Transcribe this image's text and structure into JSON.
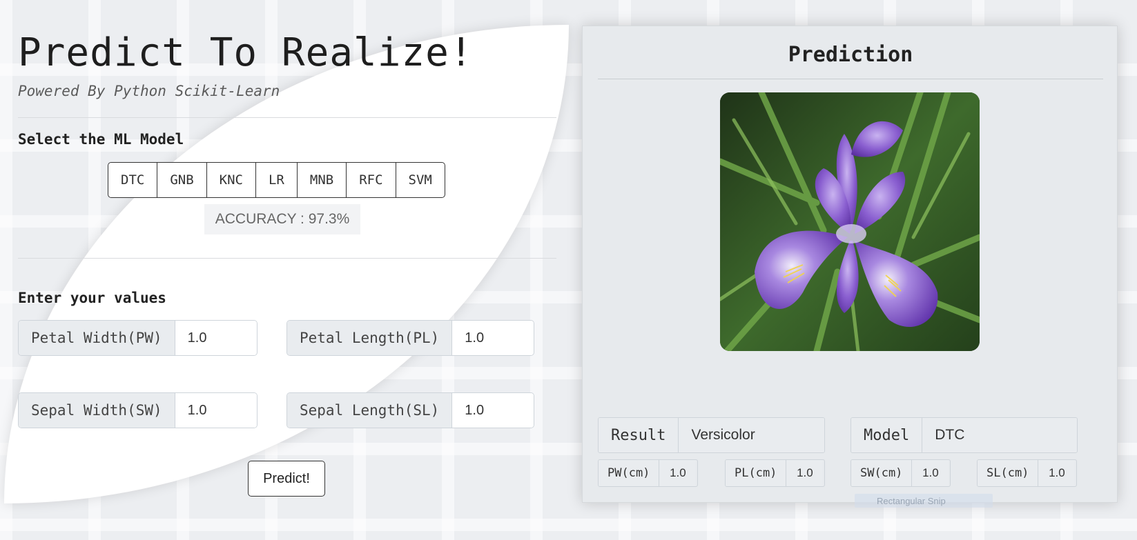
{
  "header": {
    "title": "Predict To Realize!",
    "subtitle": "Powered By Python Scikit-Learn"
  },
  "model_section": {
    "label": "Select the ML Model",
    "models": [
      "DTC",
      "GNB",
      "KNC",
      "LR",
      "MNB",
      "RFC",
      "SVM"
    ],
    "accuracy": "ACCURACY : 97.3%"
  },
  "values_section": {
    "label": "Enter your values",
    "fields": {
      "pw": {
        "label": "Petal Width(PW)",
        "value": "1.0"
      },
      "pl": {
        "label": "Petal Length(PL)",
        "value": "1.0"
      },
      "sw": {
        "label": "Sepal Width(SW)",
        "value": "1.0"
      },
      "sl": {
        "label": "Sepal Length(SL)",
        "value": "1.0"
      }
    },
    "predict_label": "Predict!"
  },
  "prediction": {
    "title": "Prediction",
    "image_icon": "iris-flower-image",
    "result_label": "Result",
    "result_value": "Versicolor",
    "model_label": "Model",
    "model_value": "DTC",
    "summary": {
      "pw": {
        "label": "PW(cm)",
        "value": "1.0"
      },
      "pl": {
        "label": "PL(cm)",
        "value": "1.0"
      },
      "sw": {
        "label": "SW(cm)",
        "value": "1.0"
      },
      "sl": {
        "label": "SL(cm)",
        "value": "1.0"
      }
    }
  },
  "overlay": {
    "text": "Rectangular Snip"
  },
  "colors": {
    "panel_bg": "#e7eaed",
    "input_label_bg": "#e9ecef",
    "flower_purple": "#8a5fd0"
  }
}
